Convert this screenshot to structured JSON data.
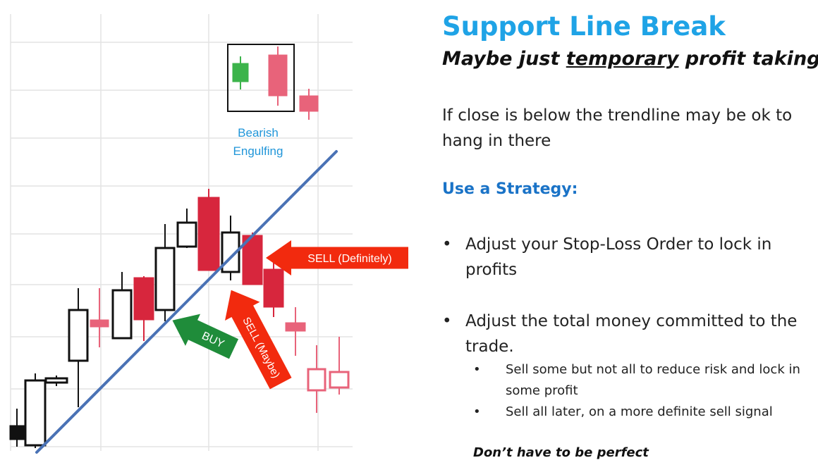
{
  "slide": {
    "title": "Support Line Break",
    "subtitle": {
      "pre": "Maybe just ",
      "emph": "temporary",
      "post": " profit taking"
    },
    "intro": "If close is below the trendline may be ok to hang in there",
    "strategy_heading": "Use a Strategy:",
    "bullets": [
      {
        "text": "Adjust your Stop-Loss Order to lock in profits"
      },
      {
        "text": "Adjust the total money committed to the trade.",
        "sub_bullets": [
          "Sell some but not all to reduce risk and lock in some profit",
          "Sell all later, on a more definite sell signal"
        ]
      }
    ],
    "bullet_symbol": "•",
    "footer": "Don’t have to be perfect"
  },
  "chart_data": {
    "type": "candlestick",
    "title": "",
    "xlabel": "",
    "ylabel": "",
    "grid": true,
    "colors": {
      "bull_fill": "#ffffff",
      "bull_stroke": "#111111",
      "bear_fill": "#d7263d",
      "bear_soft": "#e8637a",
      "trendline": "#4a72b5",
      "green_candle": "#3cb44b",
      "sell_arrow": "#f22a0e",
      "buy_arrow": "#1f8c3a",
      "label_blue": "#2196d9"
    },
    "candles": [
      {
        "o": 0,
        "h": 0,
        "l": 0,
        "c": 0,
        "style": "bear_dark"
      },
      {
        "o": 0,
        "h": 0,
        "l": 0,
        "c": 0,
        "style": "bull"
      },
      {
        "o": 0,
        "h": 0,
        "l": 0,
        "c": 0,
        "style": "bull_doji"
      },
      {
        "o": 0,
        "h": 0,
        "l": 0,
        "c": 0,
        "style": "bull_wick"
      },
      {
        "o": 0,
        "h": 0,
        "l": 0,
        "c": 0,
        "style": "bear_soft_doji"
      },
      {
        "o": 0,
        "h": 0,
        "l": 0,
        "c": 0,
        "style": "bull"
      },
      {
        "o": 0,
        "h": 0,
        "l": 0,
        "c": 0,
        "style": "bear"
      },
      {
        "o": 0,
        "h": 0,
        "l": 0,
        "c": 0,
        "style": "bull"
      },
      {
        "o": 0,
        "h": 0,
        "l": 0,
        "c": 0,
        "style": "bull"
      },
      {
        "o": 0,
        "h": 0,
        "l": 0,
        "c": 0,
        "style": "bear"
      },
      {
        "o": 0,
        "h": 0,
        "l": 0,
        "c": 0,
        "style": "bull"
      },
      {
        "o": 0,
        "h": 0,
        "l": 0,
        "c": 0,
        "style": "bear"
      },
      {
        "o": 0,
        "h": 0,
        "l": 0,
        "c": 0,
        "style": "bear"
      },
      {
        "o": 0,
        "h": 0,
        "l": 0,
        "c": 0,
        "style": "bear_soft_doji"
      },
      {
        "o": 0,
        "h": 0,
        "l": 0,
        "c": 0,
        "style": "bear_soft_hollow"
      },
      {
        "o": 0,
        "h": 0,
        "l": 0,
        "c": 0,
        "style": "bear_soft_hollow"
      }
    ],
    "inset_pattern": {
      "label": "Bearish Engulfing",
      "candles": [
        {
          "o": 0,
          "h": 0,
          "l": 0,
          "c": 0,
          "style": "green"
        },
        {
          "o": 0,
          "h": 0,
          "l": 0,
          "c": 0,
          "style": "bear_soft"
        },
        {
          "o": 0,
          "h": 0,
          "l": 0,
          "c": 0,
          "style": "bear_soft"
        }
      ]
    },
    "annotations": [
      {
        "label": "SELL (Definitely)",
        "kind": "sell"
      },
      {
        "label": "SELL (Maybe)",
        "kind": "sell"
      },
      {
        "label": "BUY",
        "kind": "buy"
      }
    ]
  }
}
